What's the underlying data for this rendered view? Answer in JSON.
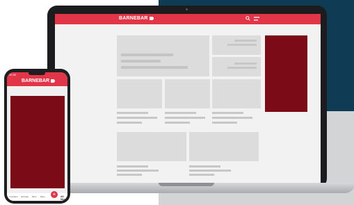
{
  "brand": {
    "name": "BARNEBAR",
    "accent": "#e03648",
    "ad_color": "#7b0c17",
    "navy": "#0f3b55"
  },
  "desktop": {
    "logo": "BARNEBAR",
    "icons": [
      "search-icon",
      "menu-icon"
    ]
  },
  "mobile": {
    "time": "12:30",
    "logo": "BARNEBAR",
    "tabs": [
      "Forsiden",
      "Nyheder",
      "Mine",
      "Mere"
    ],
    "fab": "+",
    "more_label": "Alt\nMere"
  }
}
